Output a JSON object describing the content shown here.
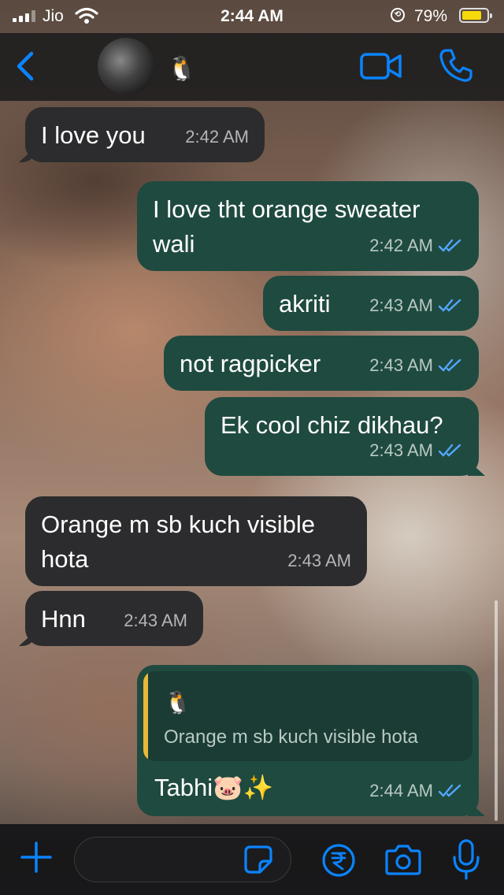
{
  "status_bar": {
    "carrier": "Jio",
    "time": "2:44 AM",
    "battery_percent": "79%",
    "battery_level": 0.79,
    "icons": [
      "signal-icon",
      "wifi-icon",
      "orientation-lock-icon",
      "battery-icon"
    ]
  },
  "header": {
    "contact_name": "🐧",
    "icons": [
      "back-chevron-icon",
      "avatar",
      "video-call-icon",
      "phone-icon"
    ]
  },
  "messages": [
    {
      "direction": "incoming",
      "text": "I love you",
      "time": "2:42 AM"
    },
    {
      "direction": "outgoing",
      "text": "I love tht orange sweater wali",
      "time": "2:42 AM",
      "read": true
    },
    {
      "direction": "outgoing",
      "text": "akriti",
      "time": "2:43 AM",
      "read": true
    },
    {
      "direction": "outgoing",
      "text": "not ragpicker",
      "time": "2:43 AM",
      "read": true
    },
    {
      "direction": "outgoing",
      "text": "Ek cool chiz dikhau?",
      "time": "2:43 AM",
      "read": true
    },
    {
      "direction": "incoming",
      "text": "Orange m sb kuch visible hota",
      "time": "2:43 AM"
    },
    {
      "direction": "incoming",
      "text": "Hnn",
      "time": "2:43 AM"
    },
    {
      "direction": "outgoing",
      "reply_to": {
        "sender": "🐧",
        "text": "Orange m sb kuch visible hota"
      },
      "text": "Tabhi🐷✨",
      "time": "2:44 AM",
      "read": true
    }
  ],
  "input_bar": {
    "placeholder": "",
    "value": "",
    "icons": [
      "plus-icon",
      "sticker-icon",
      "rupee-payment-icon",
      "camera-icon",
      "microphone-icon"
    ]
  },
  "colors": {
    "accent": "#0a84ff",
    "outgoing_bubble": "#1f4a40",
    "incoming_bubble": "#2c2c2e",
    "read_ticks": "#53a6ff",
    "reply_bar": "#e6b93a",
    "battery_fill": "#f5d90a"
  }
}
